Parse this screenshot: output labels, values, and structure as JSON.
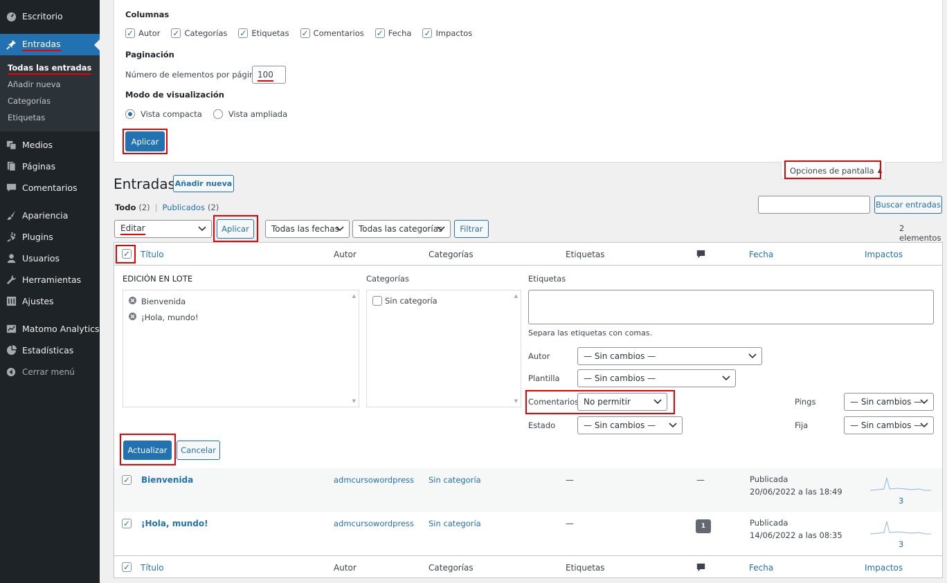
{
  "sidebar": {
    "items": [
      {
        "label": "Escritorio",
        "icon": "dashboard-icon"
      },
      {
        "label": "Entradas",
        "icon": "pin-icon"
      },
      {
        "label": "Medios",
        "icon": "media-icon"
      },
      {
        "label": "Páginas",
        "icon": "pages-icon"
      },
      {
        "label": "Comentarios",
        "icon": "comments-icon"
      },
      {
        "label": "Apariencia",
        "icon": "brush-icon"
      },
      {
        "label": "Plugins",
        "icon": "plug-icon"
      },
      {
        "label": "Usuarios",
        "icon": "user-icon"
      },
      {
        "label": "Herramientas",
        "icon": "wrench-icon"
      },
      {
        "label": "Ajustes",
        "icon": "settings-icon"
      },
      {
        "label": "Matomo Analytics",
        "icon": "analytics-icon"
      },
      {
        "label": "Estadísticas",
        "icon": "pie-icon"
      }
    ],
    "submenu": [
      "Todas las entradas",
      "Añadir nueva",
      "Categorías",
      "Etiquetas"
    ],
    "collapse": "Cerrar menú"
  },
  "screen_options": {
    "columns_title": "Columnas",
    "columns": [
      "Autor",
      "Categorías",
      "Etiquetas",
      "Comentarios",
      "Fecha",
      "Impactos"
    ],
    "pagination_title": "Paginación",
    "per_page_label": "Número de elementos por página:",
    "per_page_value": "100",
    "view_mode_title": "Modo de visualización",
    "view_compact": "Vista compacta",
    "view_extended": "Vista ampliada",
    "apply": "Aplicar",
    "tab_label": "Opciones de pantalla"
  },
  "page": {
    "title": "Entradas",
    "add_new": "Añadir nueva",
    "filter_all": "Todo",
    "filter_all_count": "(2)",
    "filter_sep": "|",
    "filter_published": "Publicados",
    "filter_published_count": "(2)",
    "search_button": "Buscar entradas",
    "bulk_action": "Editar",
    "apply": "Aplicar",
    "dates": "Todas las fechas",
    "categories": "Todas las categorías",
    "filter_button": "Filtrar",
    "count": "2 elementos"
  },
  "table": {
    "headers": {
      "title": "Título",
      "author": "Autor",
      "categories": "Categorías",
      "tags": "Etiquetas",
      "date": "Fecha",
      "impacts": "Impactos"
    },
    "bulk": {
      "title": "EDICIÓN EN LOTE",
      "items": [
        "Bienvenida",
        "¡Hola, mundo!"
      ],
      "categories_label": "Categorías",
      "no_category": "Sin categoría",
      "tags_label": "Etiquetas",
      "tags_help": "Separa las etiquetas con comas.",
      "author_label": "Autor",
      "author_value": "— Sin cambios —",
      "template_label": "Plantilla",
      "template_value": "— Sin cambios —",
      "comments_label": "Comentarios",
      "comments_value": "No permitir",
      "pings_label": "Pings",
      "pings_value": "— Sin cambios —",
      "status_label": "Estado",
      "status_value": "— Sin cambios —",
      "sticky_label": "Fija",
      "sticky_value": "— Sin cambios —",
      "update": "Actualizar",
      "cancel": "Cancelar"
    },
    "rows": [
      {
        "title": "Bienvenida",
        "author": "admcursowordpress",
        "category": "Sin categoría",
        "tags": "—",
        "comments": "—",
        "status": "Publicada",
        "date": "20/06/2022 a las 18:49",
        "impacts": "3"
      },
      {
        "title": "¡Hola, mundo!",
        "author": "admcursowordpress",
        "category": "Sin categoría",
        "tags": "—",
        "comments": "1",
        "status": "Publicada",
        "date": "14/06/2022 a las 08:35",
        "impacts": "3"
      }
    ]
  }
}
